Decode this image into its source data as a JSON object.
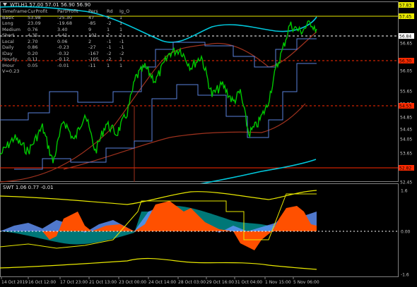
{
  "main_chart": {
    "title": "WTI,H1  57.00 57.01 56.90 56.90",
    "table": {
      "columns": [
        "Timeframe",
        "CurProfit",
        "PartProfit",
        "Pers",
        "Rd",
        "Ig_O"
      ],
      "rows": [
        [
          "Basic",
          "53.98",
          "-25.30",
          "47",
          "1",
          "1"
        ],
        [
          "Long",
          "23.09",
          "-19.68",
          "-85",
          "-2",
          "1"
        ],
        [
          "Medium",
          "0.76",
          "3.40",
          "9",
          "1",
          "1"
        ],
        [
          "Short",
          "4.35",
          "4.41",
          "101",
          "2",
          "2"
        ],
        [
          "Local",
          "2.70",
          "0.06",
          "2",
          "-1",
          "-1"
        ],
        [
          "Daily",
          "0.86",
          "-0.23",
          "-27",
          "-1",
          "-1"
        ],
        [
          "IDay",
          "0.20",
          "-0.32",
          "-167",
          "-2",
          "-2"
        ],
        [
          "Hourly",
          "0.11",
          "-0.12",
          "-105",
          "-2",
          "1"
        ],
        [
          "IHour",
          "0.05",
          "-0.01",
          "-11",
          "1",
          "1"
        ]
      ],
      "footer": "V=0.23"
    },
    "price_ticks": [
      "57.83",
      "57.45",
      "56.84",
      "56.65",
      "56.30",
      "56.05",
      "55.65",
      "55.25",
      "54.85",
      "54.53",
      "54.45",
      "54.05",
      "53.65",
      "53.25",
      "52.82",
      "52.45"
    ],
    "price_badges": [
      {
        "label": "57.83",
        "color": "#e8e800",
        "text_color": "#000000"
      },
      {
        "label": "57.45",
        "color": "#e8e800",
        "text_color": "#000000"
      },
      {
        "label": "56.84",
        "color": "#ffffff",
        "text_color": "#000000"
      },
      {
        "label": "56.30",
        "color": "#ff2a00",
        "text_color": "#000000"
      },
      {
        "label": "54.53",
        "color": "#ff2a00",
        "text_color": "#000000"
      },
      {
        "label": "52.82",
        "color": "#ff2a00",
        "text_color": "#000000"
      }
    ]
  },
  "sub_chart": {
    "title": "SWT 1.06 0.77 -0.01",
    "ticks": [
      "1.6",
      "0.00",
      "-1.6"
    ]
  },
  "time_axis": [
    "14 Oct 2019",
    "16 Oct 12:00",
    "17 Oct 23:00",
    "21 Oct 13:00",
    "23 Oct 00:00",
    "24 Oct 14:00",
    "28 Oct 03:00",
    "29 Oct 16:00",
    "31 Oct 04:00",
    "1 Nov 15:00",
    "5 Nov 06:00"
  ],
  "colors": {
    "background": "#000000",
    "candles": "#00c800",
    "ma_cyan": "#00c8dc",
    "ma_brown": "#a0321e",
    "band_blue": "#5a82dc",
    "level_red": "#ff2a00",
    "osc_orange": "#ff5000",
    "osc_blue": "#6496ff",
    "osc_teal": "#008c8c",
    "osc_yellow": "#e8e800"
  }
}
